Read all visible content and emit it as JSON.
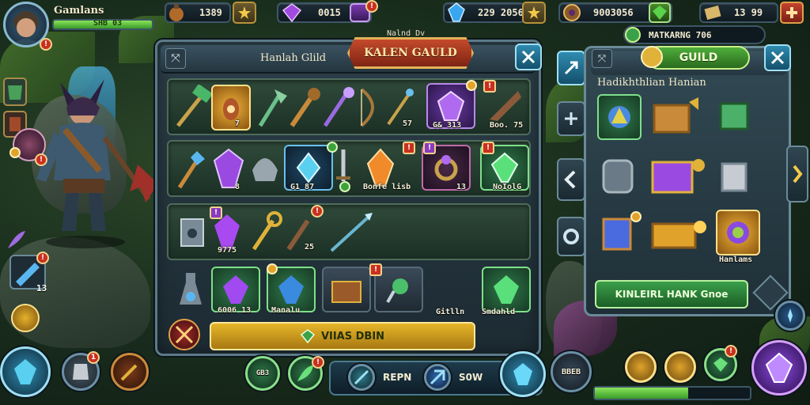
{
  "player": {
    "name": "Gamlans",
    "xp_text": "SHB 03"
  },
  "currencies": [
    {
      "icon": "potion-icon",
      "value": "1389"
    },
    {
      "icon": "purple-gem-icon",
      "value": "0015"
    },
    {
      "icon": "blue-crystal-icon",
      "value": "229 2056"
    },
    {
      "icon": "amulet-icon",
      "value": "9003056"
    },
    {
      "icon": "scroll-icon",
      "value": "13 99"
    }
  ],
  "guild_status": {
    "label": "MATKARNG 706"
  },
  "main_panel": {
    "tab_label": "Hanlah Glild",
    "banner": "KALEN GAULD",
    "banner_caption": "Nalnd Dv",
    "shelf1_labels": [
      "7",
      "57",
      "G& 313",
      "Boo. 75"
    ],
    "shelf2_labels": [
      "8",
      "G1 87",
      "Bonfe lisb",
      "13",
      "NoIolG"
    ],
    "shelf3_labels": [
      "9775",
      "25"
    ],
    "shelf4_labels": [
      "6006 13",
      "Manalu",
      "Gitlln",
      "Smdahld"
    ],
    "action_label": "VIIAS DBIN"
  },
  "right_panel": {
    "guild_button": "GUILD",
    "heading": "Hadikhthlian Hanian",
    "slot_label": "Hanlams",
    "primary_button": "KINLEIRL HANK Gnoe"
  },
  "bottom": {
    "left_badge": "1",
    "center_a": "REPN",
    "center_b": "S0W",
    "slot_a": "GB3",
    "slot_b": "BBEB",
    "left_counter": "13"
  },
  "colors": {
    "panel_border": "#5c7a88",
    "banner_red": "#c44a2a",
    "gold": "#e6b62a",
    "guild_green": "#4fae3a",
    "xp_green": "#6cd43a"
  }
}
